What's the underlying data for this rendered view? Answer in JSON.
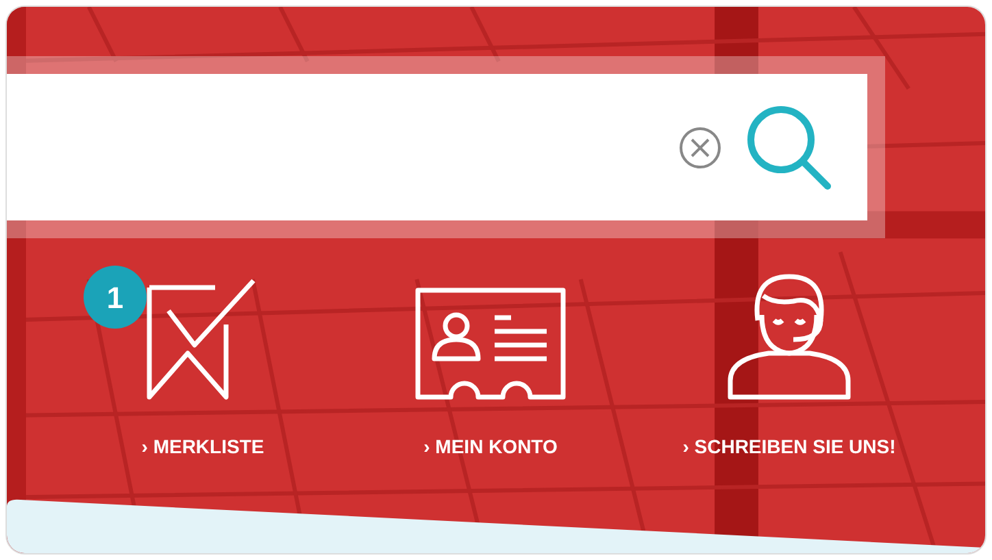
{
  "search": {
    "clear_button": true
  },
  "links": [
    {
      "kind": "bookmark",
      "label": "› MERKLISTE",
      "badge": "1"
    },
    {
      "kind": "account",
      "label": "› MEIN KONTO"
    },
    {
      "kind": "support",
      "label": "› SCHREIBEN SIE UNS!"
    }
  ]
}
